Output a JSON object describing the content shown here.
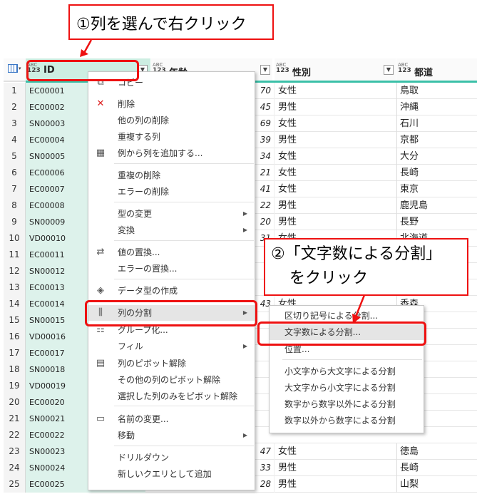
{
  "callout1": "①列を選んで右クリック",
  "callout2": {
    "line1": "②「文字数による分割」",
    "line2": "をクリック"
  },
  "grid": {
    "type_tag_top": "ABC",
    "type_tag_bottom": "123",
    "columns": [
      {
        "name": "ID"
      },
      {
        "name": "年齢"
      },
      {
        "name": "性別"
      },
      {
        "name": "都道"
      }
    ]
  },
  "rows": [
    {
      "n": "1",
      "id": "EC00001",
      "age": "70",
      "sex": "女性",
      "pref": "鳥取"
    },
    {
      "n": "2",
      "id": "EC00002",
      "age": "45",
      "sex": "男性",
      "pref": "沖縄"
    },
    {
      "n": "3",
      "id": "SN00003",
      "age": "69",
      "sex": "女性",
      "pref": "石川"
    },
    {
      "n": "4",
      "id": "EC00004",
      "age": "39",
      "sex": "男性",
      "pref": "京都"
    },
    {
      "n": "5",
      "id": "SN00005",
      "age": "34",
      "sex": "女性",
      "pref": "大分"
    },
    {
      "n": "6",
      "id": "EC00006",
      "age": "21",
      "sex": "女性",
      "pref": "長崎"
    },
    {
      "n": "7",
      "id": "EC00007",
      "age": "41",
      "sex": "女性",
      "pref": "東京"
    },
    {
      "n": "8",
      "id": "EC00008",
      "age": "22",
      "sex": "男性",
      "pref": "鹿児島"
    },
    {
      "n": "9",
      "id": "SN00009",
      "age": "20",
      "sex": "男性",
      "pref": "長野"
    },
    {
      "n": "10",
      "id": "VD00010",
      "age": "31",
      "sex": "女性",
      "pref": "北海道"
    },
    {
      "n": "11",
      "id": "EC00011",
      "age": "",
      "sex": "",
      "pref": ""
    },
    {
      "n": "12",
      "id": "SN00012",
      "age": "",
      "sex": "",
      "pref": ""
    },
    {
      "n": "13",
      "id": "EC00013",
      "age": "",
      "sex": "",
      "pref": ""
    },
    {
      "n": "14",
      "id": "EC00014",
      "age": "43",
      "sex": "女性",
      "pref": "香森"
    },
    {
      "n": "15",
      "id": "SN00015",
      "age": "",
      "sex": "",
      "pref": ""
    },
    {
      "n": "16",
      "id": "VD00016",
      "age": "",
      "sex": "",
      "pref": ""
    },
    {
      "n": "17",
      "id": "EC00017",
      "age": "",
      "sex": "",
      "pref": ""
    },
    {
      "n": "18",
      "id": "SN00018",
      "age": "",
      "sex": "",
      "pref": ""
    },
    {
      "n": "19",
      "id": "VD00019",
      "age": "",
      "sex": "",
      "pref": ""
    },
    {
      "n": "20",
      "id": "EC00020",
      "age": "",
      "sex": "",
      "pref": ""
    },
    {
      "n": "21",
      "id": "SN00021",
      "age": "",
      "sex": "",
      "pref": ""
    },
    {
      "n": "22",
      "id": "EC00022",
      "age": "",
      "sex": "",
      "pref": ""
    },
    {
      "n": "23",
      "id": "SN00023",
      "age": "47",
      "sex": "女性",
      "pref": "徳島"
    },
    {
      "n": "24",
      "id": "SN00024",
      "age": "33",
      "sex": "男性",
      "pref": "長崎"
    },
    {
      "n": "25",
      "id": "EC00025",
      "age": "28",
      "sex": "男性",
      "pref": "山梨"
    }
  ],
  "menu": {
    "items": [
      {
        "label": "コピー",
        "icon": "copy-icon"
      },
      {
        "label": "削除",
        "icon": "delete-x-icon"
      },
      {
        "label": "他の列の削除"
      },
      {
        "label": "重複する列"
      },
      {
        "label": "例から列を追加する...",
        "icon": "add-column-example-icon"
      },
      {
        "label": "重複の削除"
      },
      {
        "label": "エラーの削除"
      },
      {
        "label": "型の変更",
        "has_submenu": true
      },
      {
        "label": "変換",
        "has_submenu": true
      },
      {
        "label": "値の置換...",
        "icon": "replace-values-icon"
      },
      {
        "label": "エラーの置換..."
      },
      {
        "label": "データ型の作成",
        "icon": "data-type-icon"
      },
      {
        "label": "列の分割",
        "icon": "split-column-icon",
        "has_submenu": true
      },
      {
        "label": "グループ化...",
        "icon": "group-by-icon"
      },
      {
        "label": "フィル",
        "has_submenu": true
      },
      {
        "label": "列のピボット解除",
        "icon": "unpivot-icon"
      },
      {
        "label": "その他の列のピボット解除"
      },
      {
        "label": "選択した列のみをピボット解除"
      },
      {
        "label": "名前の変更...",
        "icon": "rename-icon"
      },
      {
        "label": "移動",
        "has_submenu": true
      },
      {
        "label": "ドリルダウン"
      },
      {
        "label": "新しいクエリとして追加"
      }
    ]
  },
  "submenu": {
    "items": [
      {
        "label": "区切り記号による分割..."
      },
      {
        "label": "文字数による分割..."
      },
      {
        "label": "位置..."
      },
      {
        "label": "小文字から大文字による分割"
      },
      {
        "label": "大文字から小文字による分割"
      },
      {
        "label": "数字から数字以外による分割"
      },
      {
        "label": "数字以外から数字による分割"
      }
    ]
  },
  "colors": {
    "highlight": "#e11111",
    "id_column": "#ddf2eb",
    "accent": "#3ac0a8"
  }
}
